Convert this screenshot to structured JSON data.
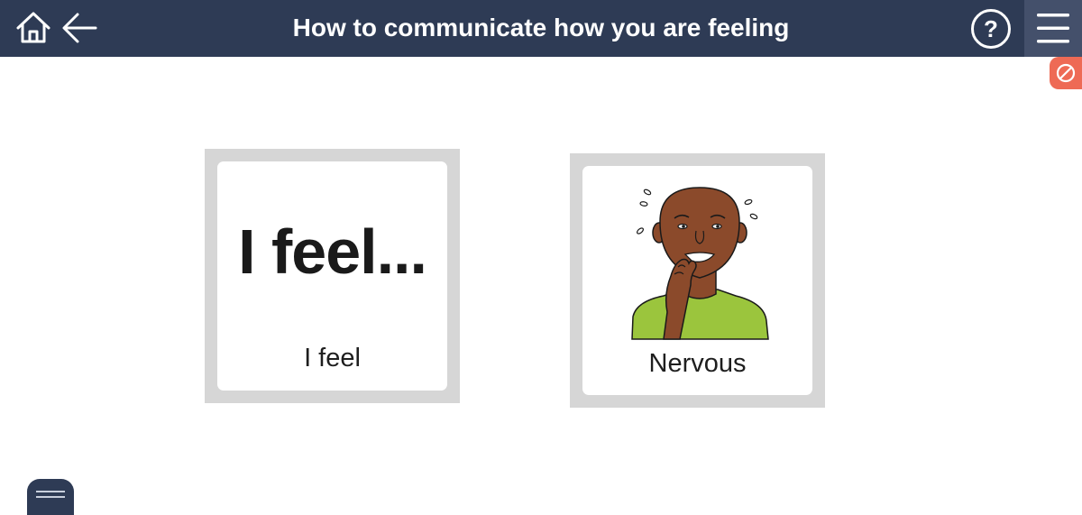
{
  "header": {
    "title": "How to communicate how you are feeling",
    "icons": {
      "home": "home-icon",
      "back": "arrow-left-icon",
      "help": "question-circle-icon",
      "menu": "hamburger-menu-icon",
      "block": "block-icon"
    }
  },
  "cards": [
    {
      "symbol_text": "I feel...",
      "label": "I feel"
    },
    {
      "image": "nervous-person-icon",
      "label": "Nervous"
    }
  ],
  "colors": {
    "header_bg": "#2e3b55",
    "menu_bg": "#44506b",
    "badge_bg": "#ee6a55",
    "card_frame": "#d6d6d6",
    "shirt": "#9bc53d",
    "skin": "#8b4a2b"
  },
  "bottom_tab": {
    "icon": "drawer-handle-icon"
  }
}
